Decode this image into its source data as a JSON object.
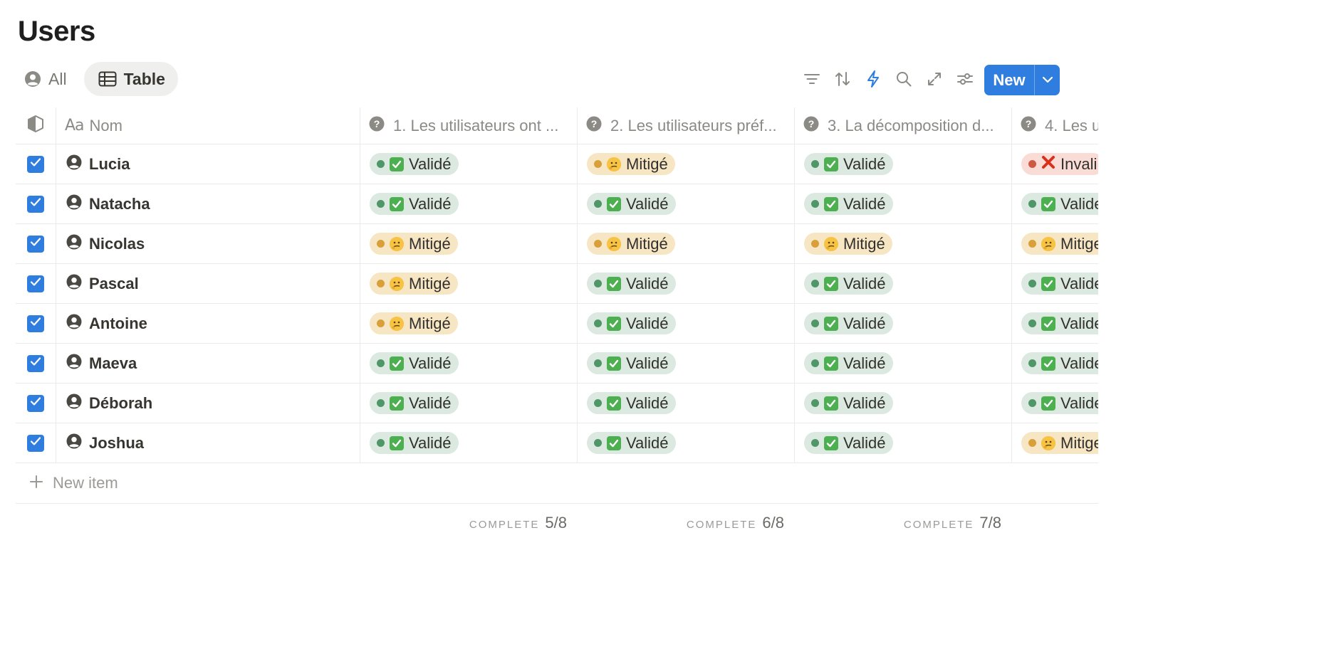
{
  "page": {
    "title": "Users"
  },
  "views": [
    {
      "label": "All",
      "icon": "user-circle-icon",
      "active": false
    },
    {
      "label": "Table",
      "icon": "table-icon",
      "active": true
    }
  ],
  "toolbar": {
    "icons": [
      "filter-icon",
      "sort-icon",
      "automation-icon",
      "search-icon",
      "expand-icon",
      "settings-icon"
    ],
    "new_label": "New",
    "accent": "#2f7dde"
  },
  "table": {
    "columns": [
      {
        "label": "Nom",
        "icon": "text-property-icon"
      },
      {
        "label": "1. Les utilisateurs ont ...",
        "icon": "question-icon"
      },
      {
        "label": "2. Les utilisateurs préf...",
        "icon": "question-icon"
      },
      {
        "label": "3. La décomposition d...",
        "icon": "question-icon"
      },
      {
        "label": "4. Les u",
        "icon": "question-icon"
      }
    ],
    "rows": [
      {
        "name": "Lucia",
        "checked": true,
        "values": [
          {
            "text": "Validé",
            "status": "valide"
          },
          {
            "text": "Mitigé",
            "status": "mitige"
          },
          {
            "text": "Validé",
            "status": "valide"
          },
          {
            "text": "Invali",
            "status": "invalide"
          }
        ]
      },
      {
        "name": "Natacha",
        "checked": true,
        "values": [
          {
            "text": "Validé",
            "status": "valide"
          },
          {
            "text": "Validé",
            "status": "valide"
          },
          {
            "text": "Validé",
            "status": "valide"
          },
          {
            "text": "Valide",
            "status": "valide"
          }
        ]
      },
      {
        "name": "Nicolas",
        "checked": true,
        "values": [
          {
            "text": "Mitigé",
            "status": "mitige"
          },
          {
            "text": "Mitigé",
            "status": "mitige"
          },
          {
            "text": "Mitigé",
            "status": "mitige"
          },
          {
            "text": "Mitige",
            "status": "mitige"
          }
        ]
      },
      {
        "name": "Pascal",
        "checked": true,
        "values": [
          {
            "text": "Mitigé",
            "status": "mitige"
          },
          {
            "text": "Validé",
            "status": "valide"
          },
          {
            "text": "Validé",
            "status": "valide"
          },
          {
            "text": "Valide",
            "status": "valide"
          }
        ]
      },
      {
        "name": "Antoine",
        "checked": true,
        "values": [
          {
            "text": "Mitigé",
            "status": "mitige"
          },
          {
            "text": "Validé",
            "status": "valide"
          },
          {
            "text": "Validé",
            "status": "valide"
          },
          {
            "text": "Valide",
            "status": "valide"
          }
        ]
      },
      {
        "name": "Maeva",
        "checked": true,
        "values": [
          {
            "text": "Validé",
            "status": "valide"
          },
          {
            "text": "Validé",
            "status": "valide"
          },
          {
            "text": "Validé",
            "status": "valide"
          },
          {
            "text": "Valide",
            "status": "valide"
          }
        ]
      },
      {
        "name": "Déborah",
        "checked": true,
        "values": [
          {
            "text": "Validé",
            "status": "valide"
          },
          {
            "text": "Validé",
            "status": "valide"
          },
          {
            "text": "Validé",
            "status": "valide"
          },
          {
            "text": "Valide",
            "status": "valide"
          }
        ]
      },
      {
        "name": "Joshua",
        "checked": true,
        "values": [
          {
            "text": "Validé",
            "status": "valide"
          },
          {
            "text": "Validé",
            "status": "valide"
          },
          {
            "text": "Validé",
            "status": "valide"
          },
          {
            "text": "Mitige",
            "status": "mitige"
          }
        ]
      }
    ],
    "new_item_label": "New item",
    "calculations": [
      {
        "label": "COMPLETE",
        "value": "5/8"
      },
      {
        "label": "COMPLETE",
        "value": "6/8"
      },
      {
        "label": "COMPLETE",
        "value": "7/8"
      }
    ]
  },
  "status_colors": {
    "valide": "#4f9768",
    "mitige": "#d9a03a",
    "invalide": "#cf5a44"
  }
}
